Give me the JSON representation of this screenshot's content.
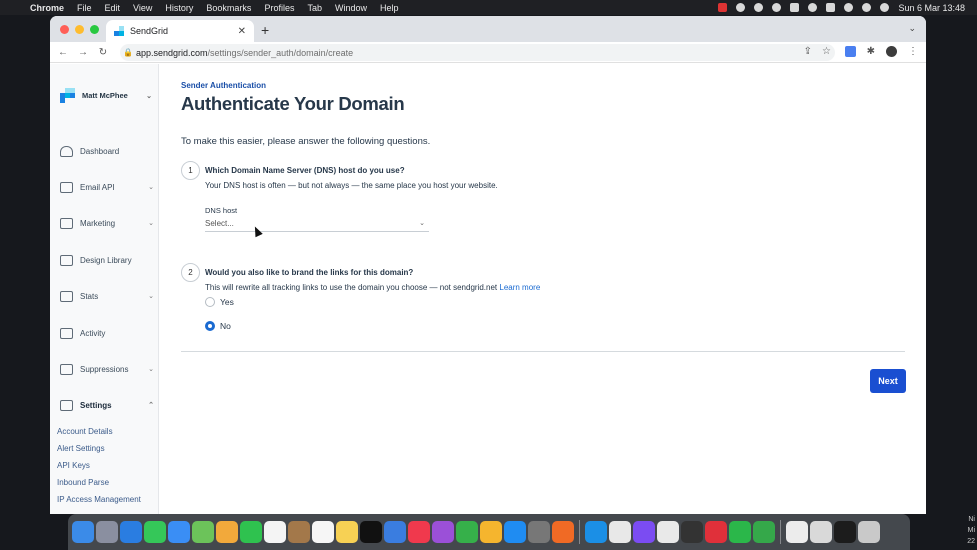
{
  "menubar": {
    "items": [
      "Chrome",
      "File",
      "Edit",
      "View",
      "History",
      "Bookmarks",
      "Profiles",
      "Tab",
      "Window",
      "Help"
    ],
    "clock": "Sun 6 Mar  13:48"
  },
  "browser": {
    "tab_title": "SendGrid",
    "url_host": "app.sendgrid.com",
    "url_path": "/settings/sender_auth/domain/create"
  },
  "sidebar": {
    "account_name": "Matt McPhee",
    "items": [
      {
        "label": "Dashboard"
      },
      {
        "label": "Email API"
      },
      {
        "label": "Marketing"
      },
      {
        "label": "Design Library"
      },
      {
        "label": "Stats"
      },
      {
        "label": "Activity"
      },
      {
        "label": "Suppressions"
      },
      {
        "label": "Settings"
      }
    ],
    "sub_items": [
      "Account Details",
      "Alert Settings",
      "API Keys",
      "Inbound Parse",
      "IP Access Management"
    ]
  },
  "main": {
    "eyebrow": "Sender Authentication",
    "title": "Authenticate Your Domain",
    "intro": "To make this easier, please answer the following questions.",
    "q1": {
      "num": "1",
      "question": "Which Domain Name Server (DNS) host do you use?",
      "help": "Your DNS host is often — but not always — the same place you host your website.",
      "field_label": "DNS host",
      "select_value": "Select..."
    },
    "q2": {
      "num": "2",
      "question": "Would you also like to brand the links for this domain?",
      "help": "This will rewrite all tracking links to use the domain you choose — not sendgrid.net",
      "learn_more": "Learn more",
      "options": [
        {
          "label": "Yes",
          "selected": false
        },
        {
          "label": "No",
          "selected": true
        }
      ]
    },
    "next_label": "Next"
  },
  "desktop": {
    "corner_text": [
      "Ni",
      "Mi",
      "22"
    ]
  },
  "colors": {
    "primary": "#1a4fd1",
    "link": "#1a6ad1",
    "heading": "#27384a"
  }
}
